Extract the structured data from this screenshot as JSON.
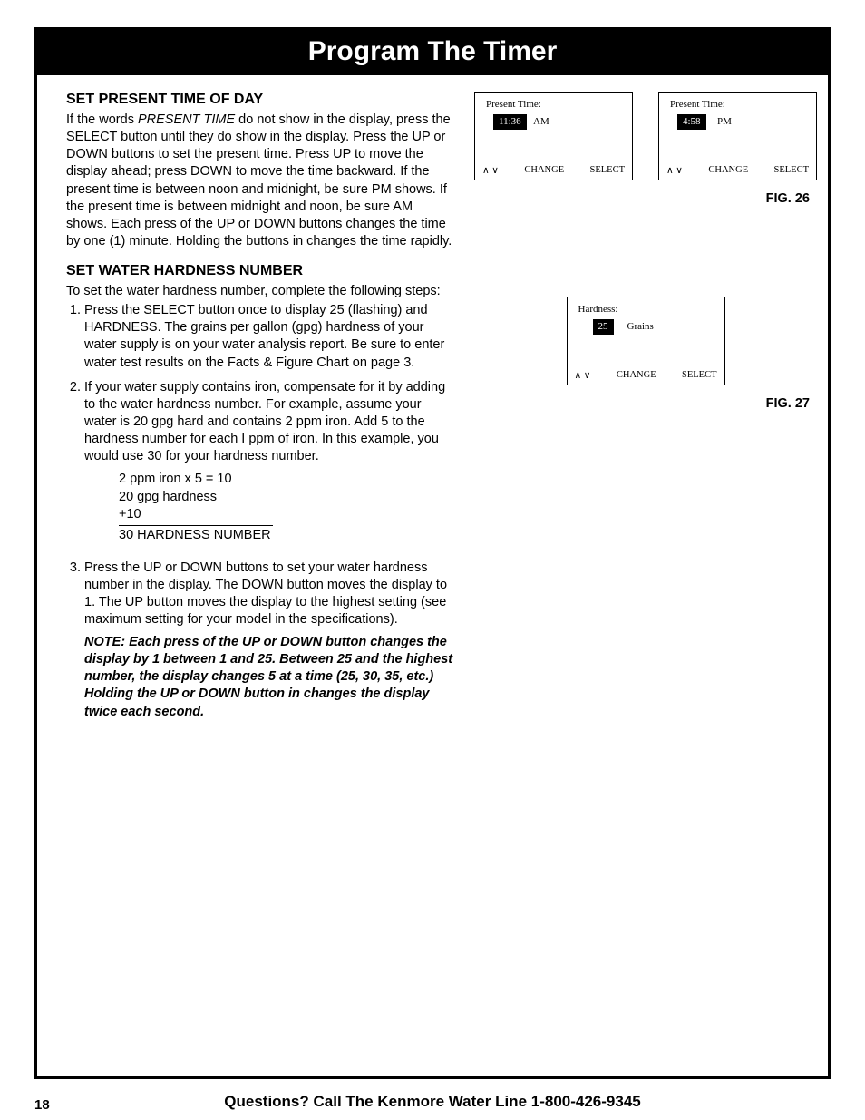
{
  "title": "Program The Timer",
  "section1": {
    "heading": "SET PRESENT TIME OF DAY",
    "body_pre": "If the words ",
    "body_italic": "PRESENT TIME",
    "body_post": " do not show in the display, press the SELECT button until they do show in the display. Press the UP or DOWN buttons to set the present time. Press UP to move the display ahead; press DOWN to move the time backward. If the present time is between noon and midnight, be sure PM shows. If the present time is between midnight and noon, be sure AM shows. Each press of the UP or DOWN buttons changes the time by one (1) minute. Holding the buttons in changes the time rapidly."
  },
  "section2": {
    "heading": "SET WATER HARDNESS NUMBER",
    "intro": "To set the water hardness number, complete the following steps:",
    "step1_pre": "Press the SELECT button once to display 25 (flashing) and ",
    "step1_italic": "HARDNESS.",
    "step1_post": " The grains per gallon (gpg) hardness of your water supply is on your water analysis report. Be sure to enter water test results on the Facts & Figure Chart on page 3.",
    "step2_pre": "If your water supply contains iron, compensate for it by adding to the water hardness number. ",
    "step2_italic": "For example, assume your water is 20 gpg hard and contains 2 ppm iron. Add 5 to the hardness number for each I ppm of iron. In this example, you would use 30 for your hardness number.",
    "calc": {
      "l1": "2 ppm iron x 5 = 10",
      "l2": "20 gpg hardness",
      "l3": "+10",
      "l4": "30 HARDNESS NUMBER"
    },
    "step3": "Press the UP or DOWN buttons to set your water hardness number in the display. The DOWN button moves the display to 1. The UP button moves the display to the highest setting (see maximum setting for your model in the specifications).",
    "note": "NOTE: Each press of the UP or DOWN button changes the display by 1 between 1 and 25. Between 25 and the highest number, the display changes 5 at a time (25, 30, 35, etc.) Holding the UP or DOWN button in changes the display twice each second."
  },
  "fig26": {
    "dispA": {
      "label": "Present Time:",
      "value": "11:36",
      "ampm": "AM"
    },
    "dispB": {
      "label": "Present Time:",
      "value": "4:58",
      "ampm": "PM"
    },
    "buttons": {
      "arrows": "∧ ∨",
      "change": "CHANGE",
      "select": "SELECT"
    },
    "caption": "FIG. 26"
  },
  "fig27": {
    "disp": {
      "label": "Hardness:",
      "value": "25",
      "unit": "Grains"
    },
    "buttons": {
      "arrows": "∧ ∨",
      "change": "CHANGE",
      "select": "SELECT"
    },
    "caption": "FIG. 27"
  },
  "footer": "Questions? Call The Kenmore Water Line 1-800-426-9345",
  "page": "18"
}
